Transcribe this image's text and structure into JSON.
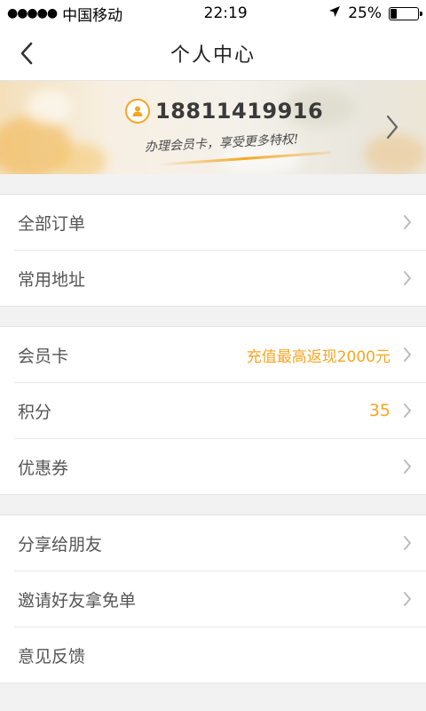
{
  "status_bar": {
    "signal_dots": "●●●●●",
    "carrier": "中国移动",
    "time": "22:19",
    "battery_percent": "25%",
    "battery_level": 0.25
  },
  "nav": {
    "title": "个人中心",
    "back_icon": "chevron-left-icon"
  },
  "banner": {
    "phone": "18811419916",
    "slogan": "办理会员卡，享受更多特权!",
    "avatar_icon": "user-icon",
    "arrow_icon": "chevron-right-icon"
  },
  "groups": [
    {
      "items": [
        {
          "label": "全部订单",
          "value": ""
        },
        {
          "label": "常用地址",
          "value": ""
        }
      ]
    },
    {
      "items": [
        {
          "label": "会员卡",
          "value": "充值最高返现2000元"
        },
        {
          "label": "积分",
          "value": "35"
        },
        {
          "label": "优惠券",
          "value": ""
        }
      ]
    },
    {
      "items": [
        {
          "label": "分享给朋友",
          "value": ""
        },
        {
          "label": "邀请好友拿免单",
          "value": ""
        },
        {
          "label": "意见反馈",
          "value": ""
        }
      ]
    }
  ],
  "colors": {
    "accent": "#f5a623",
    "background": "#f2f2f2"
  }
}
